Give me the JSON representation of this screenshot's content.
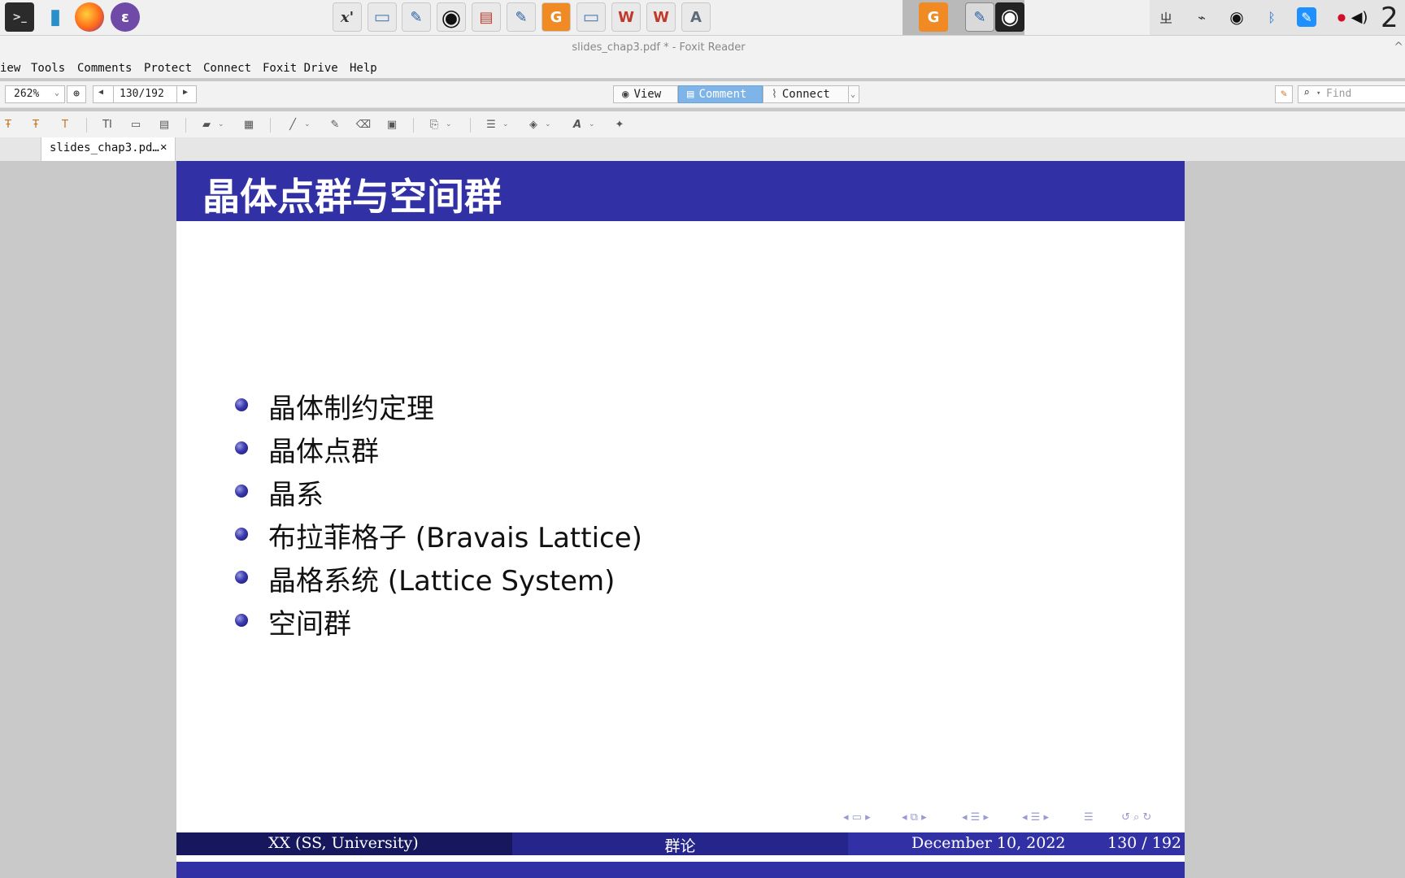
{
  "taskbar": {
    "left_apps": [
      {
        "name": "terminal-icon",
        "glyph": ">_"
      },
      {
        "name": "file-manager-icon",
        "glyph": "▮"
      },
      {
        "name": "firefox-icon",
        "glyph": "●"
      },
      {
        "name": "emacs-icon",
        "glyph": "ε"
      }
    ],
    "center_apps": [
      {
        "name": "xmaxima-icon",
        "glyph": "x'"
      },
      {
        "name": "folder-icon",
        "glyph": "▭"
      },
      {
        "name": "pdf-signature-icon",
        "glyph": "✎"
      },
      {
        "name": "obs-icon",
        "glyph": "◉"
      },
      {
        "name": "document-viewer-icon",
        "glyph": "▤"
      },
      {
        "name": "pdf-signature-icon-2",
        "glyph": "✎"
      },
      {
        "name": "foxit-reader-icon",
        "glyph": "G"
      },
      {
        "name": "folder-open-icon",
        "glyph": "▭"
      },
      {
        "name": "wps-writer-icon",
        "glyph": "W"
      },
      {
        "name": "wps-office-icon",
        "glyph": "W"
      },
      {
        "name": "xournal-icon",
        "glyph": "A"
      }
    ],
    "running_apps": [
      {
        "name": "foxit-running-icon",
        "glyph": "G"
      },
      {
        "name": "pdf-running-icon",
        "glyph": "✎"
      },
      {
        "name": "obs-running-icon",
        "glyph": "◉"
      }
    ],
    "tray": [
      {
        "name": "input-method-icon",
        "glyph": "ㄓ"
      },
      {
        "name": "network-icon",
        "glyph": "⌁"
      },
      {
        "name": "obs-tray-icon",
        "glyph": "◉"
      },
      {
        "name": "bluetooth-icon",
        "glyph": "ᛒ"
      },
      {
        "name": "pen-icon",
        "glyph": "✎"
      },
      {
        "name": "microphone-icon",
        "glyph": "●"
      },
      {
        "name": "volume-icon",
        "glyph": "◀)"
      }
    ],
    "clock_fragment": "2"
  },
  "window": {
    "title": "slides_chap3.pdf * - Foxit Reader",
    "caret": "^"
  },
  "menu": [
    "iew",
    "Tools",
    "Comments",
    "Protect",
    "Connect",
    "Foxit Drive",
    "Help"
  ],
  "nav": {
    "zoom": "262%",
    "page": "130/192",
    "modes": [
      "View",
      "Comment",
      "Connect"
    ],
    "active_mode": "Comment",
    "find_placeholder": "Find"
  },
  "tab": {
    "label": "slides_chap3.pd…",
    "close": "✕"
  },
  "slide": {
    "title": "晶体点群与空间群",
    "bullets": [
      "晶体制约定理",
      "晶体点群",
      "晶系",
      "布拉菲格子 (Bravais Lattice)",
      "晶格系统 (Lattice System)",
      "空间群"
    ],
    "footer": {
      "left": "XX  (SS, University)",
      "center": "群论",
      "date": "December 10, 2022",
      "page": "130 / 192"
    }
  },
  "colors": {
    "slide_header": "#3131a5",
    "footer_dark": "#17175e",
    "footer_mid": "#25258b",
    "active_mode_bg": "#7fb4e8"
  }
}
